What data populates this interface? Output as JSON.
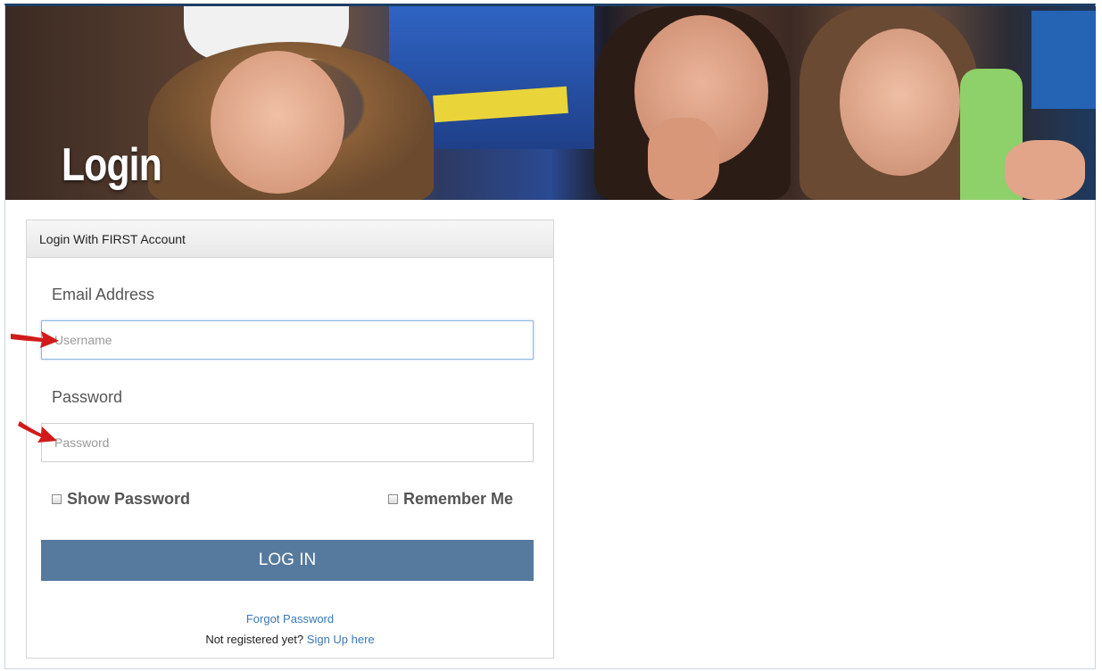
{
  "hero": {
    "title": "Login"
  },
  "panel": {
    "header": "Login With FIRST Account",
    "email_label": "Email Address",
    "username_placeholder": "Username",
    "password_label": "Password",
    "password_placeholder": "Password",
    "show_password": "Show Password",
    "remember_me": "Remember Me",
    "login_button": "LOG IN",
    "forgot_password": "Forgot Password",
    "not_registered": "Not registered yet?",
    "sign_up": "Sign Up here"
  },
  "colors": {
    "button": "#567a9e",
    "link": "#3a78b8",
    "annotation_arrow": "#d21a1a"
  }
}
